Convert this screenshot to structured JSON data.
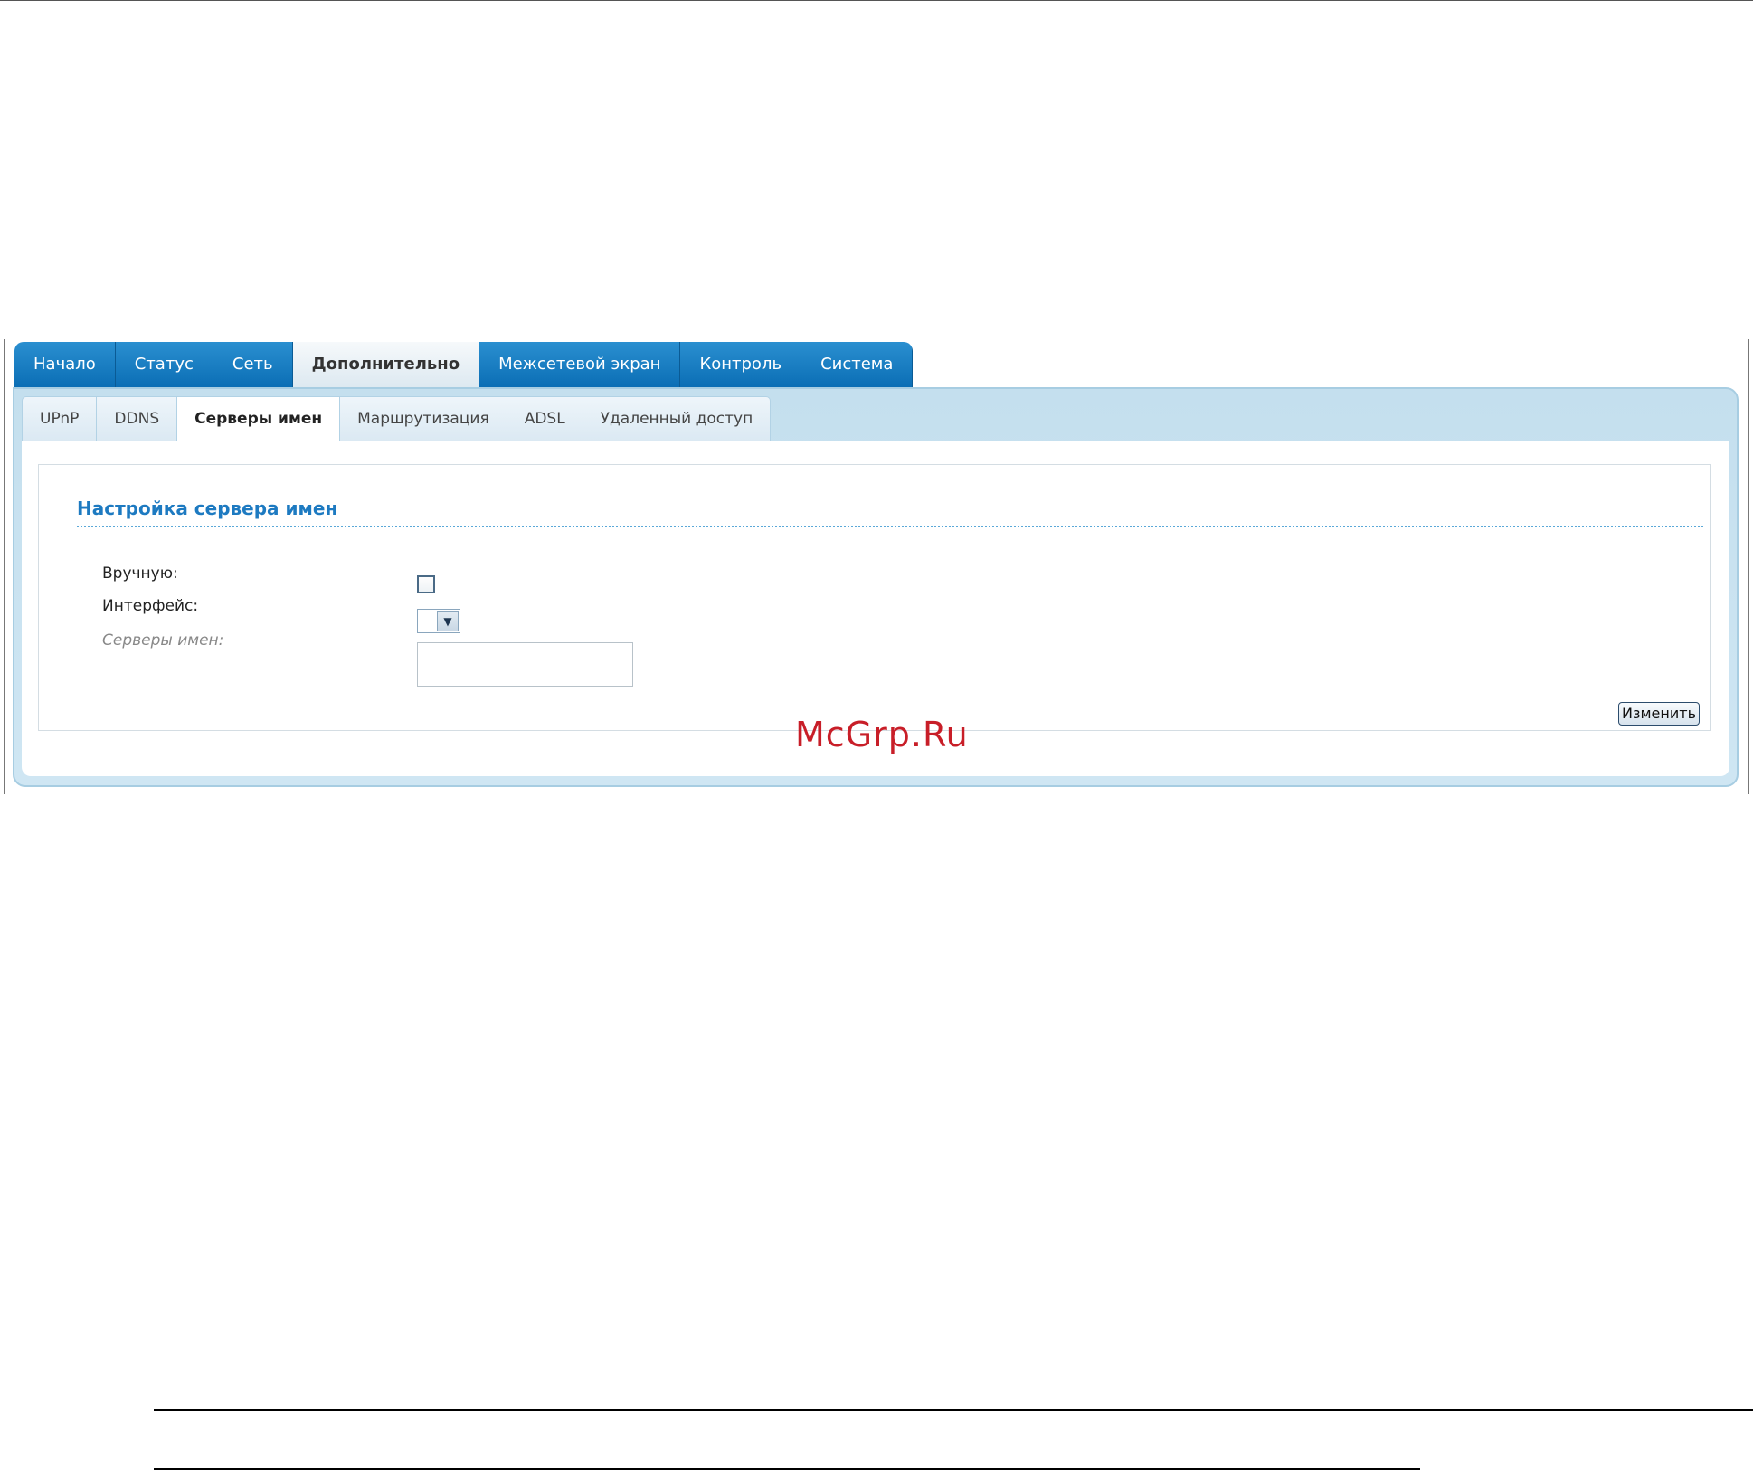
{
  "main_tabs": [
    {
      "label": "Начало"
    },
    {
      "label": "Статус"
    },
    {
      "label": "Сеть"
    },
    {
      "label": "Дополнительно",
      "active": true
    },
    {
      "label": "Межсетевой экран"
    },
    {
      "label": "Контроль"
    },
    {
      "label": "Система"
    }
  ],
  "sub_tabs": [
    {
      "label": "UPnP"
    },
    {
      "label": "DDNS"
    },
    {
      "label": "Серверы имен",
      "active": true
    },
    {
      "label": "Маршрутизация"
    },
    {
      "label": "ADSL"
    },
    {
      "label": "Удаленный доступ"
    }
  ],
  "section": {
    "title": "Настройка сервера имен"
  },
  "form": {
    "manual_label": "Вручную:",
    "manual_checked": false,
    "interface_label": "Интерфейс:",
    "interface_value": "",
    "servers_label": "Серверы имен:",
    "servers_value": "",
    "change_button": "Изменить"
  },
  "watermark": "McGrp.Ru",
  "colors": {
    "tab_blue": "#0b6eb5",
    "panel_blue": "#c4dfee",
    "title_blue": "#1d7ac1",
    "watermark_red": "#c81e28"
  }
}
